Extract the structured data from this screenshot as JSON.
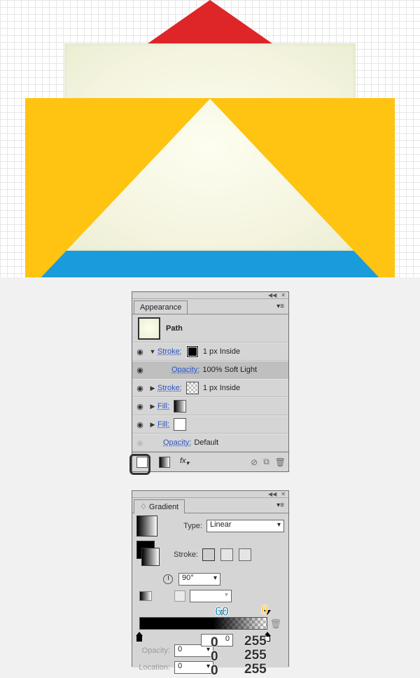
{
  "appearance_panel": {
    "tab": "Appearance",
    "object_type": "Path",
    "rows": [
      {
        "kind": "stroke",
        "label": "Stroke:",
        "value": "1 px  Inside",
        "swatch": "solid-black",
        "expanded": true,
        "visible": true
      },
      {
        "kind": "opacity",
        "label": "Opacity:",
        "value": "100% Soft Light",
        "selected": true,
        "visible": true
      },
      {
        "kind": "stroke",
        "label": "Stroke:",
        "value": "1 px  Inside",
        "swatch": "pattern",
        "expanded": false,
        "visible": true
      },
      {
        "kind": "fill",
        "label": "Fill:",
        "swatch": "grad-h",
        "expanded": false,
        "visible": true
      },
      {
        "kind": "fill",
        "label": "Fill:",
        "swatch": "white",
        "expanded": false,
        "visible": true
      },
      {
        "kind": "opacity",
        "label": "Opacity:",
        "value": "Default",
        "visible": false
      }
    ],
    "footer_fx": "fx"
  },
  "gradient_panel": {
    "tab": "Gradient",
    "type_label": "Type:",
    "type_value": "Linear",
    "stroke_label": "Stroke:",
    "angle_value": "90°",
    "aspect_value": "",
    "opacity_label": "Opacity:",
    "location_label": "Location:",
    "opacity_stops": [
      {
        "pos_pct": 60,
        "annot": "60"
      },
      {
        "pos_pct": 100,
        "annot": "0"
      }
    ],
    "color_stops": [
      {
        "pos_pct": 0,
        "rgb": "0"
      },
      {
        "pos_pct": 100,
        "rgb": "255"
      }
    ],
    "field_value": "0",
    "rgb_left": [
      "0",
      "0",
      "0"
    ],
    "rgb_right": [
      "255",
      "255",
      "255"
    ]
  }
}
